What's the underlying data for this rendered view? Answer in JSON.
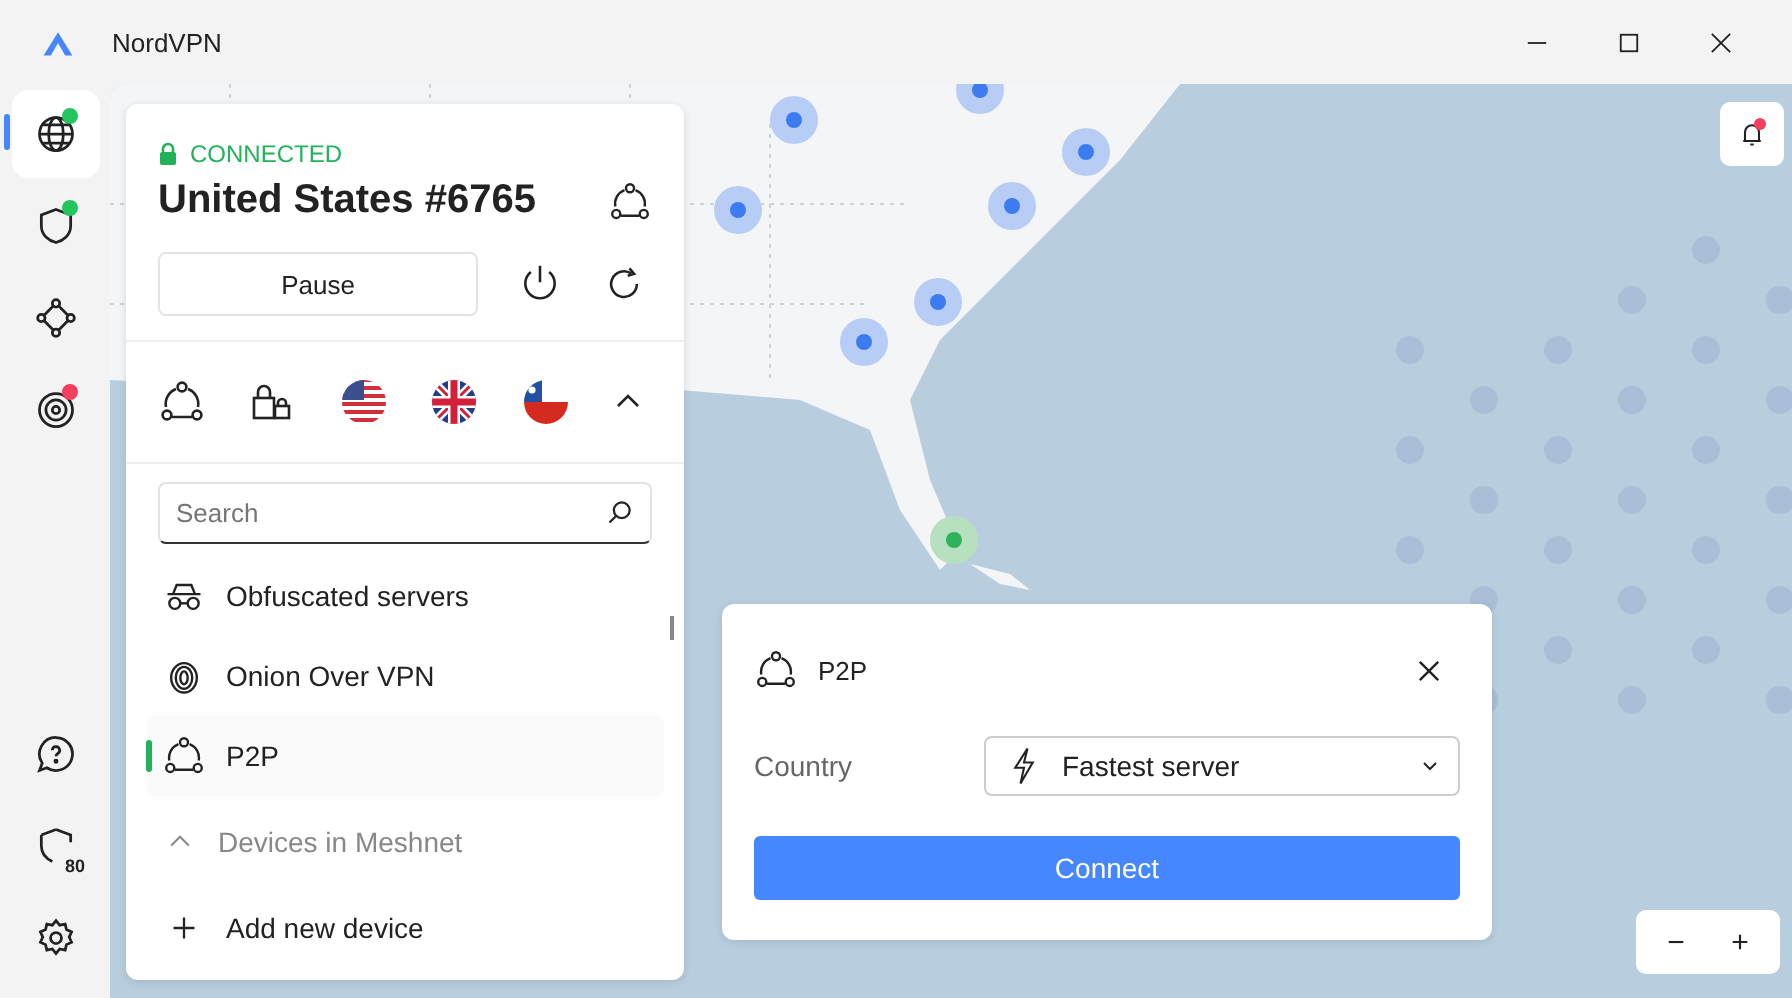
{
  "window": {
    "title": "NordVPN"
  },
  "sidebar": {
    "items": [
      {
        "kind": "globe",
        "selected": true,
        "color": "#22c55e"
      },
      {
        "kind": "shield",
        "selected": false,
        "color": "#22c55e"
      },
      {
        "kind": "meshnet",
        "selected": false
      },
      {
        "kind": "target",
        "selected": false,
        "color": "#f43f5e"
      }
    ],
    "bottom": [
      {
        "kind": "help"
      },
      {
        "kind": "threat",
        "badge": "80"
      },
      {
        "kind": "settings"
      }
    ]
  },
  "connection": {
    "status": "CONNECTED",
    "server": "United States #6765",
    "pause": "Pause"
  },
  "quick_connect": {
    "expanded": true,
    "items": [
      {
        "kind": "p2p"
      },
      {
        "kind": "dedicated-ip"
      },
      {
        "kind": "flag-us"
      },
      {
        "kind": "flag-gb"
      },
      {
        "kind": "flag-cl"
      }
    ]
  },
  "search": {
    "placeholder": "Search"
  },
  "list": [
    {
      "kind": "obfuscated",
      "label": "Obfuscated servers",
      "selected": false
    },
    {
      "kind": "onion",
      "label": "Onion Over VPN",
      "selected": false
    },
    {
      "kind": "p2p",
      "label": "P2P",
      "selected": true
    }
  ],
  "meshnet": {
    "label": "Devices in Meshnet",
    "expanded": true,
    "add": "Add new device"
  },
  "popup": {
    "title": "P2P",
    "country_label": "Country",
    "country_value": "Fastest server",
    "button": "Connect"
  },
  "notifications": {
    "unread": true
  },
  "zoom": [
    "−",
    "+"
  ]
}
